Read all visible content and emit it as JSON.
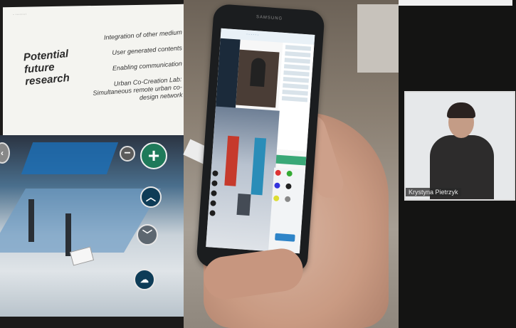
{
  "slide": {
    "small_text": "· ········",
    "title": "Potential future research",
    "items": [
      "Integration of other medium",
      "User generated contents",
      "Enabling communication",
      "Urban Co-Creation Lab: Simultaneous remote urban co-design network"
    ]
  },
  "phone": {
    "brand": "SAMSUNG",
    "app_header": "· · · · · ·"
  },
  "video_call": {
    "participant_name": "Krystyna Pietrzyk"
  },
  "colors": {
    "plus_button": "#1f7a5a",
    "nav_button": "#0e3c57",
    "map_blue": "#2a8db8",
    "map_red": "#c63a2c"
  },
  "icons": {
    "plus": "plus-icon",
    "minus": "minus-icon",
    "up": "chevron-up-icon",
    "down": "chevron-down-icon",
    "upload": "cloud-upload-icon"
  }
}
